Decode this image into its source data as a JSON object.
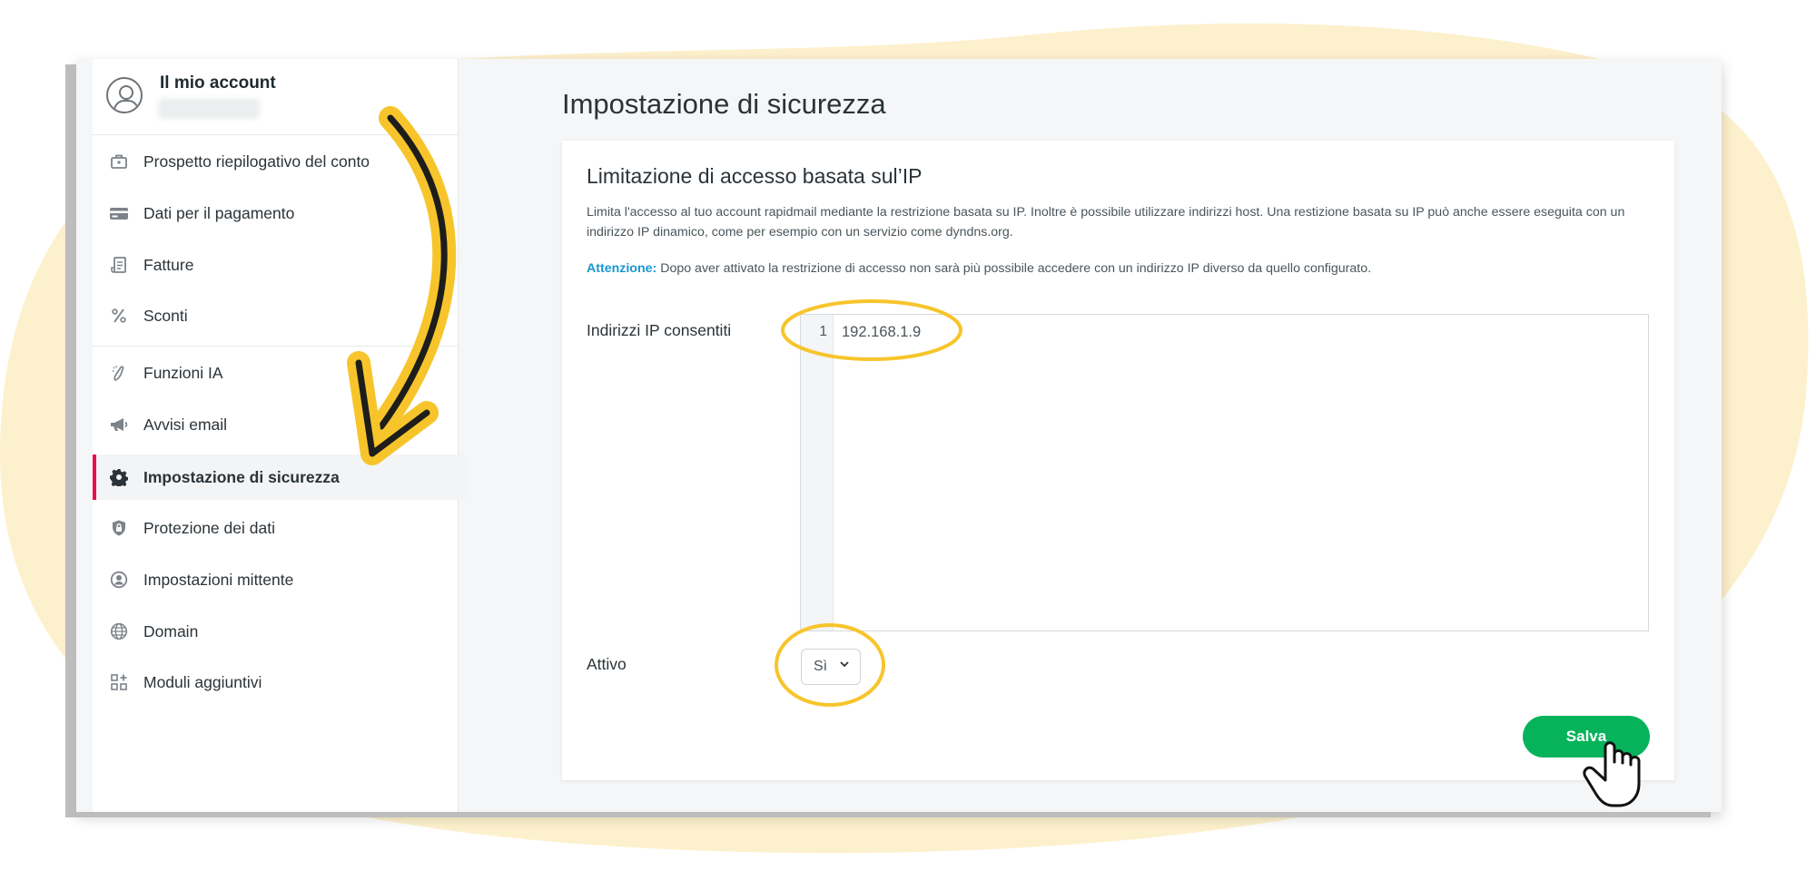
{
  "account": {
    "title": "Il mio account"
  },
  "sidebar": {
    "items": [
      {
        "label": "Prospetto riepilogativo del conto",
        "icon": "briefcase-icon"
      },
      {
        "label": "Dati per il pagamento",
        "icon": "credit-card-icon"
      },
      {
        "label": "Fatture",
        "icon": "invoice-icon"
      },
      {
        "label": "Sconti",
        "icon": "percent-icon"
      },
      {
        "label": "Funzioni IA",
        "icon": "ai-magic-icon"
      },
      {
        "label": "Avvisi email",
        "icon": "megaphone-icon"
      },
      {
        "label": "Impostazione di sicurezza",
        "icon": "gear-icon",
        "active": true
      },
      {
        "label": "Protezione dei dati",
        "icon": "shield-lock-icon"
      },
      {
        "label": "Impostazioni mittente",
        "icon": "user-circle-icon"
      },
      {
        "label": "Domain",
        "icon": "globe-icon"
      },
      {
        "label": "Moduli aggiuntivi",
        "icon": "modules-grid-icon"
      }
    ]
  },
  "main": {
    "title": "Impostazione di sicurezza",
    "card": {
      "title": "Limitazione di accesso basata sul’IP",
      "description": "Limita l'accesso al tuo account rapidmail mediante la restrizione basata su IP. Inoltre è possibile utilizzare indirizzi host. Una restizione basata su IP può anche essere eseguita con un indirizzo IP dinamico, come per esempio con un servizio come dyndns.org.",
      "warning_label": "Attenzione:",
      "warning_text": " Dopo aver attivato la restrizione di accesso non sarà più possibile accedere con un indirizzo IP diverso da quello configurato.",
      "ip_label": "Indirizzi IP consentiti",
      "ip_line_number": "1",
      "ip_value": "192.168.1.9",
      "active_label": "Attivo",
      "active_value": "Sì",
      "save_label": "Salva"
    }
  },
  "colors": {
    "accent_active": "#e8114d",
    "save_button": "#06b35b",
    "warning_label": "#1a97d4",
    "highlight_yellow": "#f7c52b",
    "background_blob": "#fdf0cc"
  }
}
